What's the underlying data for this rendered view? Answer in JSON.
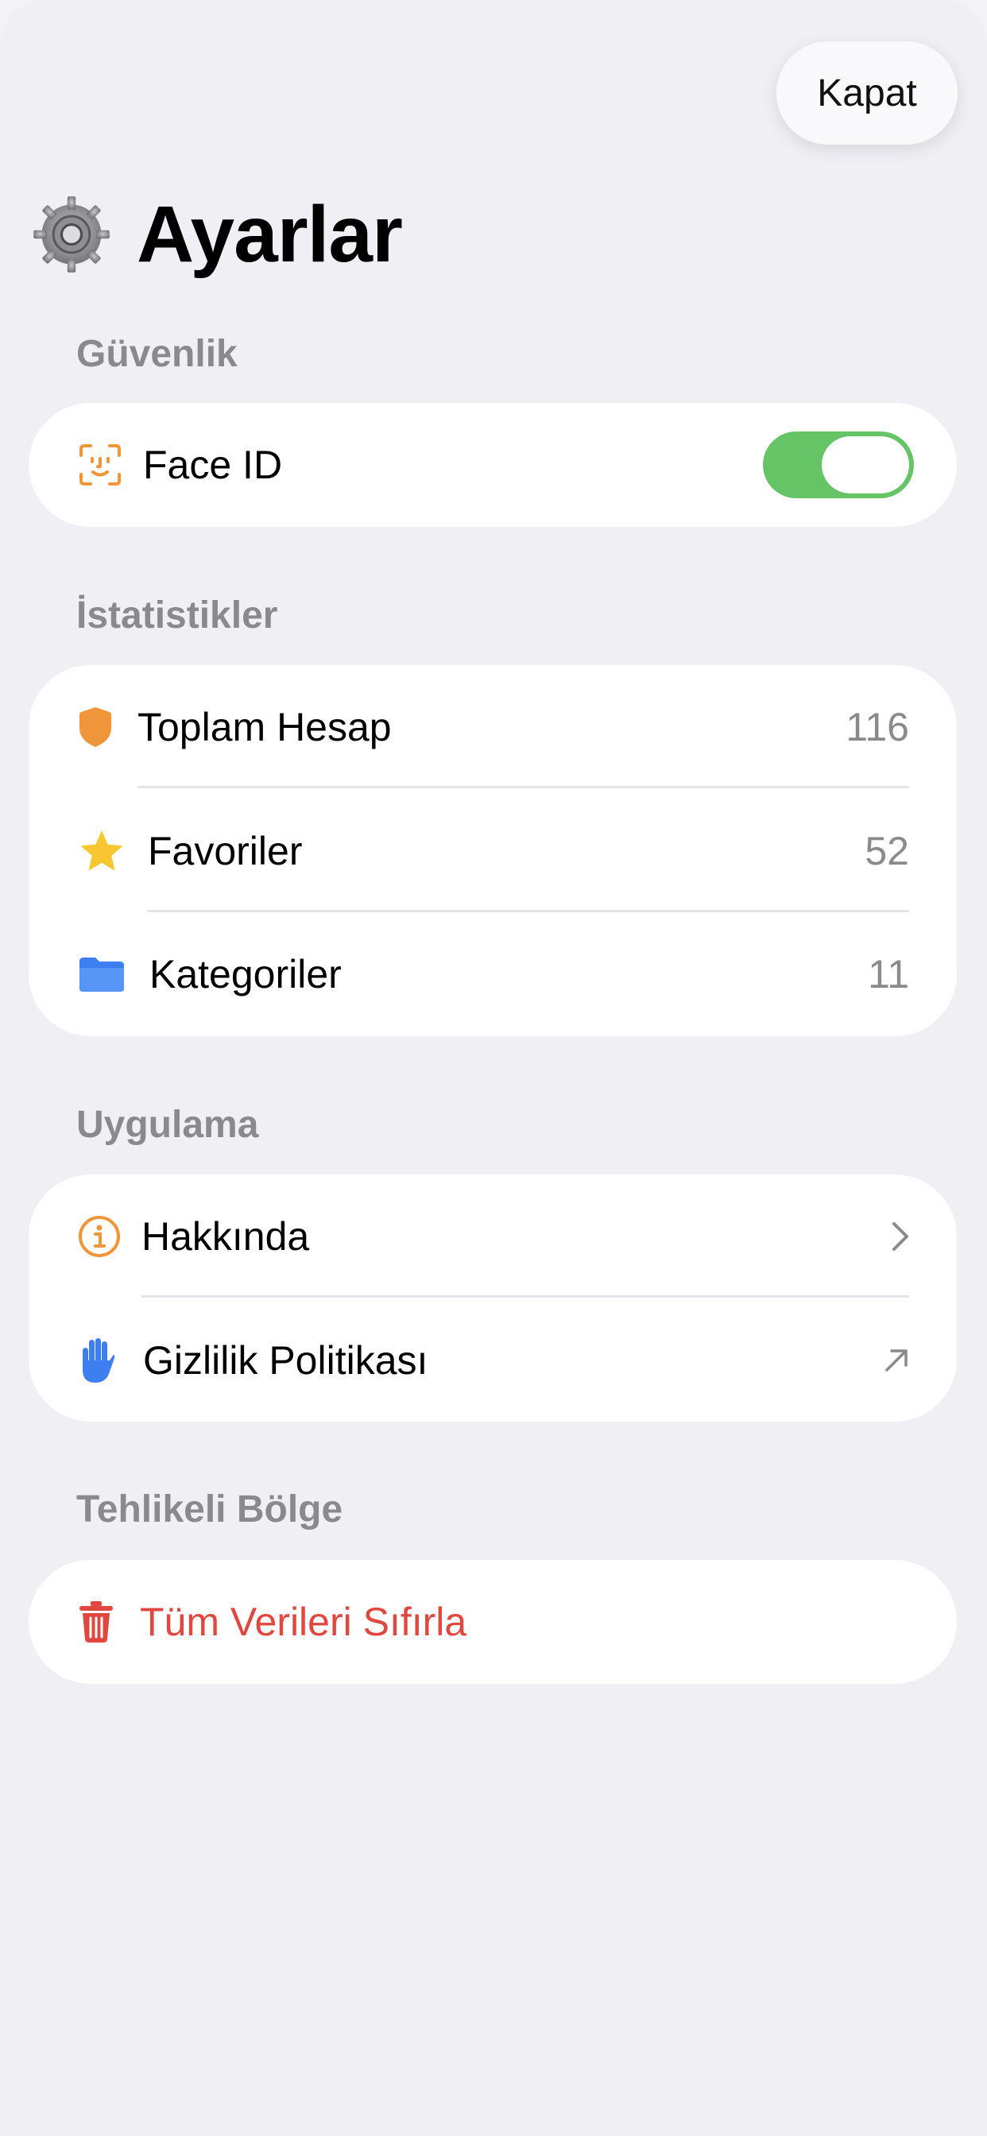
{
  "header": {
    "close_label": "Kapat",
    "title": "Ayarlar",
    "title_icon": "gear-icon"
  },
  "sections": {
    "security": {
      "header": "Güvenlik",
      "face_id": {
        "label": "Face ID",
        "icon": "face-id-icon",
        "toggle_on": true
      }
    },
    "stats": {
      "header": "İstatistikler",
      "items": [
        {
          "label": "Toplam Hesap",
          "value": "116",
          "icon": "shield-icon"
        },
        {
          "label": "Favoriler",
          "value": "52",
          "icon": "star-icon"
        },
        {
          "label": "Kategoriler",
          "value": "11",
          "icon": "folder-icon"
        }
      ]
    },
    "app": {
      "header": "Uygulama",
      "items": [
        {
          "label": "Hakkında",
          "icon": "info-icon",
          "trailing": "chevron-right-icon"
        },
        {
          "label": "Gizlilik Politikası",
          "icon": "hand-icon",
          "trailing": "external-link-arrow-icon"
        }
      ]
    },
    "danger": {
      "header": "Tehlikeli Bölge",
      "reset_label": "Tüm Verileri Sıfırla",
      "icon": "trash-icon"
    }
  },
  "colors": {
    "background": "#efeff4",
    "card": "#ffffff",
    "toggle_on": "#65c466",
    "accent_orange": "#f0963a",
    "accent_blue": "#3d7ff0",
    "accent_yellow": "#f7c631",
    "danger": "#e0473f",
    "secondary_text": "#8a8a8e"
  }
}
